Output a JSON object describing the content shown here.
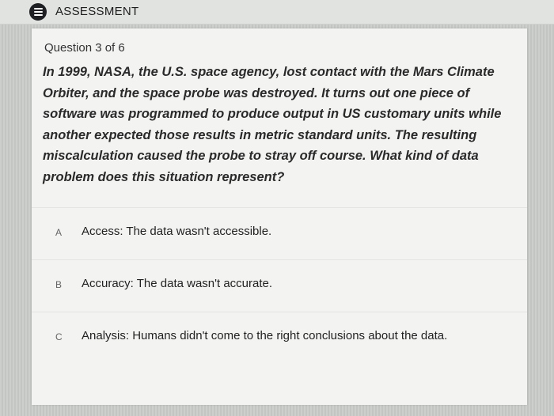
{
  "header": {
    "title": "ASSESSMENT",
    "menu_icon": "menu-icon"
  },
  "question": {
    "progress": "Question 3 of 6",
    "text": "In 1999, NASA, the U.S. space agency, lost contact with the Mars Climate Orbiter, and the space probe was destroyed. It turns out one piece of software was programmed to produce output in US customary units while another expected those results in metric standard units. The resulting miscalculation caused the probe to stray off course. What kind of data problem does this situation represent?"
  },
  "choices": [
    {
      "letter": "A",
      "text": "Access: The data wasn't accessible."
    },
    {
      "letter": "B",
      "text": "Accuracy: The data wasn't accurate."
    },
    {
      "letter": "C",
      "text": "Analysis: Humans didn't come to the right conclusions about the data."
    }
  ],
  "colors": {
    "background": "#c9cbc9",
    "card": "#f3f3f2",
    "topbar": "#e1e3e1",
    "icon": "#1d1f22"
  }
}
